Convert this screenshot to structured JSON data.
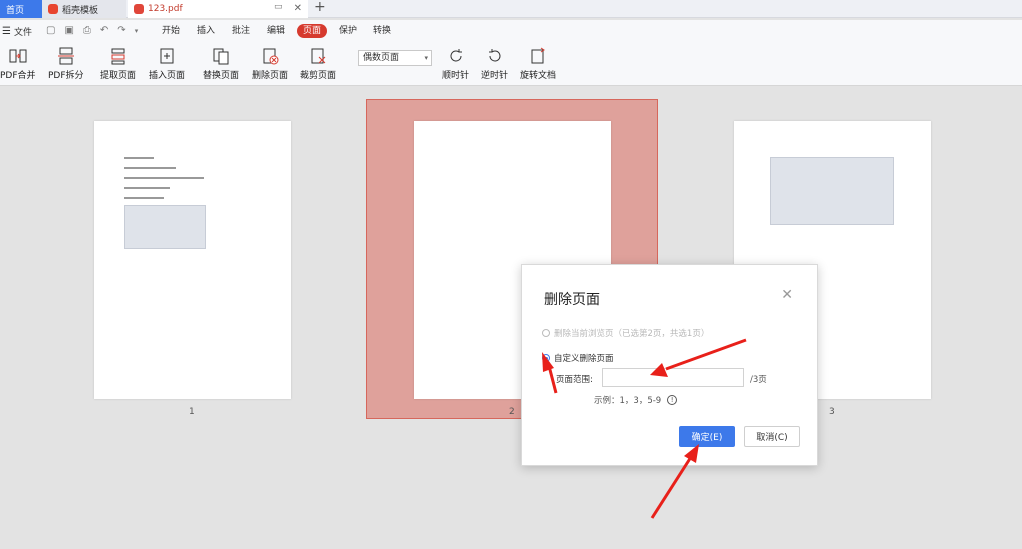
{
  "tabs": [
    {
      "label": "首页"
    },
    {
      "label": "稻壳模板"
    },
    {
      "label": "123.pdf"
    }
  ],
  "menu": {
    "file": "文件",
    "items": [
      "开始",
      "插入",
      "批注",
      "编辑",
      "页面",
      "保护",
      "转换"
    ],
    "active": "页面"
  },
  "ribbon": {
    "buttons": [
      "PDF合并",
      "PDF拆分",
      "提取页面",
      "插入页面",
      "替换页面",
      "删除页面",
      "裁剪页面"
    ],
    "select_value": "偶数页面",
    "rotate_buttons": [
      "顺时针",
      "逆时针",
      "旋转文档"
    ]
  },
  "pages": [
    {
      "number": "1"
    },
    {
      "number": "2"
    },
    {
      "number": "3"
    }
  ],
  "dialog": {
    "title": "删除页面",
    "option_current": "删除当前浏览页（已选第2页，共选1页）",
    "option_custom": "自定义删除页面",
    "range_label": "页面范围:",
    "range_value": "",
    "range_suffix": "/3页",
    "example": "示例：1，3，5-9",
    "ok_label": "确定(E)",
    "cancel_label": "取消(C)"
  },
  "colors": {
    "accent": "#3d79ea",
    "active_menu": "#d63a2e",
    "selection": "#dfa19b",
    "annotation_arrow": "#e8201a"
  }
}
